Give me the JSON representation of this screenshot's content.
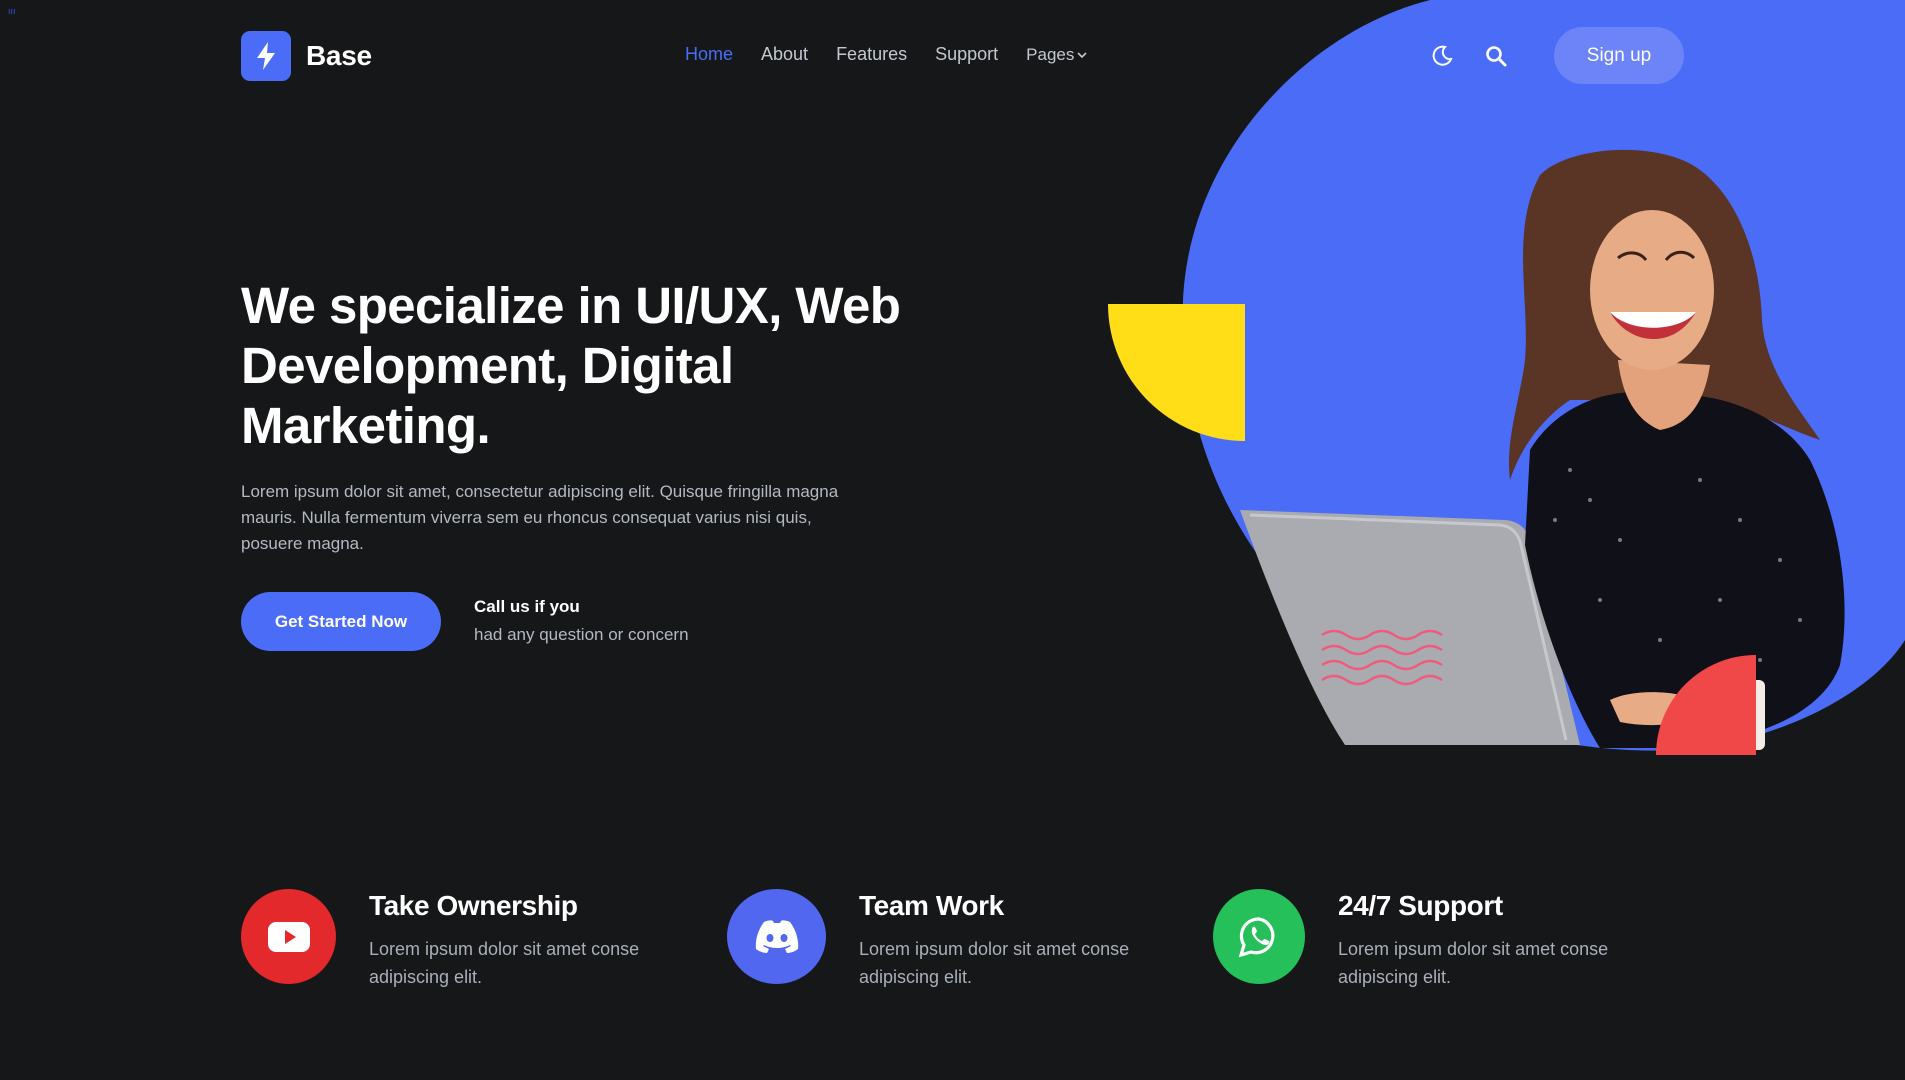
{
  "corner_mark": "ııı",
  "brand": {
    "name": "Base",
    "logo_icon": "lightning-bolt-icon",
    "accent": "#4a6cf7"
  },
  "nav": {
    "items": [
      {
        "label": "Home",
        "active": true
      },
      {
        "label": "About",
        "active": false
      },
      {
        "label": "Features",
        "active": false
      },
      {
        "label": "Support",
        "active": false
      },
      {
        "label": "Pages",
        "active": false,
        "has_dropdown": true
      }
    ]
  },
  "header_actions": {
    "theme_toggle_icon": "moon-icon",
    "search_icon": "search-icon",
    "signup_label": "Sign up"
  },
  "hero": {
    "title": "We specialize in UI/UX, Web Development, Digital Marketing.",
    "description": "Lorem ipsum dolor sit amet, consectetur adipiscing elit. Quisque fringilla magna mauris. Nulla fermentum viverra sem eu rhoncus consequat varius nisi quis, posuere magna.",
    "cta_label": "Get Started Now",
    "call_title": "Call us if you",
    "call_subtitle": "had any question or concern"
  },
  "features": [
    {
      "title": "Take Ownership",
      "description": "Lorem ipsum dolor sit amet conse adipiscing elit.",
      "icon": "youtube-icon",
      "color": "#e3292b"
    },
    {
      "title": "Team Work",
      "description": "Lorem ipsum dolor sit amet conse adipiscing elit.",
      "icon": "discord-icon",
      "color": "#5167f0"
    },
    {
      "title": "24/7 Support",
      "description": "Lorem ipsum dolor sit amet conse adipiscing elit.",
      "icon": "whatsapp-icon",
      "color": "#25c05a"
    }
  ],
  "colors": {
    "background": "#161718",
    "accent": "#4a6cf7",
    "blob": "#4a6cf7",
    "yellow": "#ffdd17",
    "red": "#f04848",
    "pink": "#f05a7e"
  }
}
